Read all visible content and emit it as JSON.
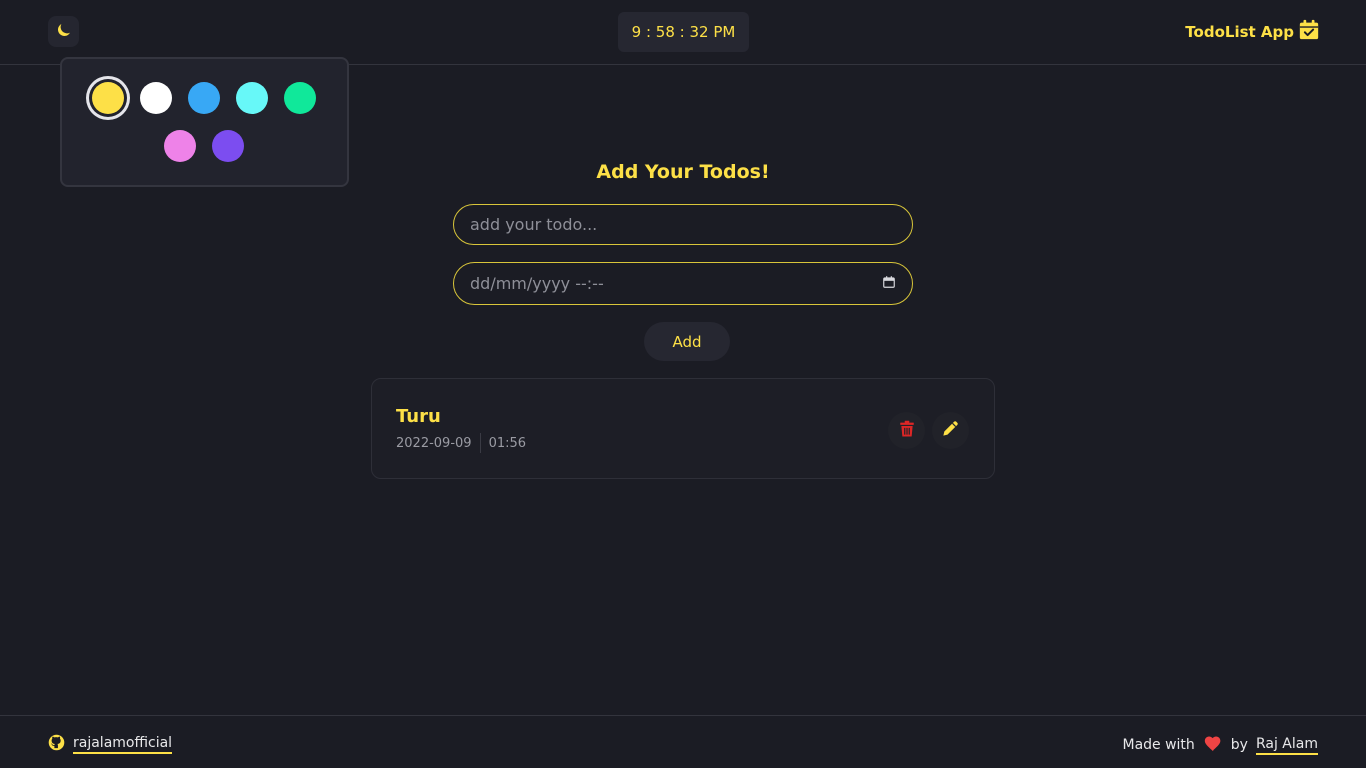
{
  "header": {
    "theme_icon": "moon-icon",
    "clock": "9 : 58 : 32 PM",
    "brand": "TodoList App",
    "brand_icon": "calendar-check-icon"
  },
  "palette": {
    "colors": [
      "#fde047",
      "#ffffff",
      "#38a8f5",
      "#67f8f8",
      "#10e89a",
      "#ee82e8",
      "#7c4df0"
    ],
    "selected": "#fde047"
  },
  "form": {
    "title": "Add Your Todos!",
    "todo_placeholder": "add your todo...",
    "date_placeholder": "dd/mm/yyyy --:--",
    "add_label": "Add"
  },
  "todos": [
    {
      "title": "Turu",
      "date": "2022-09-09",
      "time": "01:56"
    }
  ],
  "footer": {
    "github_user": "rajalamofficial",
    "made_with": "Made with",
    "by": "by",
    "author": "Raj Alam"
  },
  "theme": {
    "accent": "#fde047",
    "background": "#1b1c24",
    "danger": "#dc2626"
  }
}
